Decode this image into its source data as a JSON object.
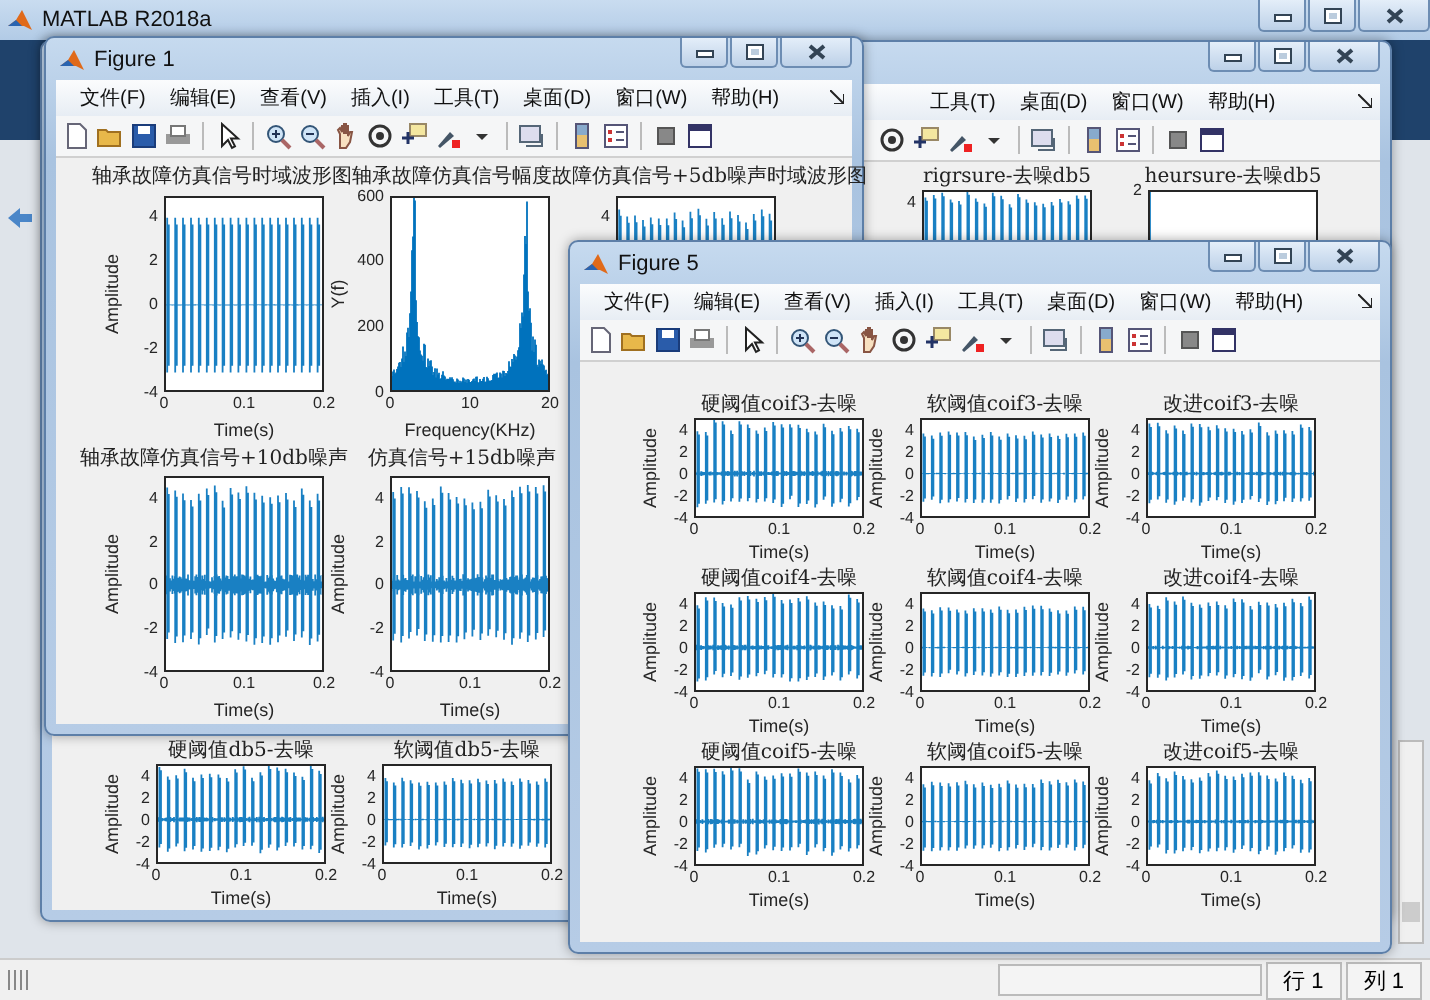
{
  "app": {
    "title": "MATLAB R2018a"
  },
  "status_bar": {
    "row": "行 1",
    "col": "列 1"
  },
  "figure_back": {
    "menu": [
      "工具(T)",
      "桌面(D)",
      "窗口(W)",
      "帮助(H)"
    ],
    "rows": [
      {
        "plots": [
          {
            "kind": "hard",
            "title": "rigrsure-去噪db5",
            "yticks": [
              "4"
            ]
          },
          {
            "kind": "sparse",
            "title": "heursure-去噪db5",
            "yticks": [
              "2"
            ]
          }
        ]
      },
      {
        "plots": [
          {
            "kind": "hard",
            "title": "硬阈值db5-去噪",
            "ylabel": "Amplitude",
            "xlabel": "Time(s)",
            "yticks": [
              "4",
              "2",
              "0",
              "-2",
              "-4"
            ],
            "xticks": [
              "0",
              "0.1",
              "0.2"
            ]
          },
          {
            "kind": "soft",
            "title": "软阈值db5-去噪",
            "ylabel": "Amplitude",
            "xlabel": "Time(s)",
            "yticks": [
              "4",
              "2",
              "0",
              "-2",
              "-4"
            ],
            "xticks": [
              "0",
              "0.1",
              "0.2"
            ]
          }
        ]
      }
    ]
  },
  "figure_1": {
    "title": "Figure 1",
    "menu": [
      "文件(F)",
      "编辑(E)",
      "查看(V)",
      "插入(I)",
      "工具(T)",
      "桌面(D)",
      "窗口(W)",
      "帮助(H)"
    ],
    "rows": [
      {
        "plots": [
          {
            "kind": "clean",
            "title": "轴承故障仿真信号时域波形图",
            "ylabel": "Amplitude",
            "xlabel": "Time(s)",
            "yticks": [
              "4",
              "2",
              "0",
              "-2",
              "-4"
            ],
            "xticks": [
              "0",
              "0.1",
              "0.2"
            ]
          },
          {
            "kind": "spectrum",
            "title": "轴承故障仿真信号幅度",
            "ylabel": "Y(f)",
            "xlabel": "Frequency(KHz)",
            "yticks": [
              "600",
              "400",
              "200",
              "0"
            ],
            "xticks": [
              "0",
              "10",
              "20"
            ]
          },
          {
            "kind": "noisy",
            "title": "故障仿真信号+5db噪声时域波形图",
            "yticks": [
              "4"
            ]
          }
        ]
      },
      {
        "plots": [
          {
            "kind": "noisy",
            "title": "轴承故障仿真信号+10db噪声",
            "ylabel": "Amplitude",
            "xlabel": "Time(s)",
            "yticks": [
              "4",
              "2",
              "0",
              "-2",
              "-4"
            ],
            "xticks": [
              "0",
              "0.1",
              "0.2"
            ]
          },
          {
            "kind": "noisy",
            "title": "仿真信号+15db噪声",
            "ylabel": "Amplitude",
            "xlabel": "Time(s)",
            "yticks": [
              "4",
              "2",
              "0",
              "-2",
              "-4"
            ],
            "xticks": [
              "0",
              "0.1",
              "0.2"
            ]
          }
        ]
      }
    ]
  },
  "figure_5": {
    "title": "Figure 5",
    "menu": [
      "文件(F)",
      "编辑(E)",
      "查看(V)",
      "插入(I)",
      "工具(T)",
      "桌面(D)",
      "窗口(W)",
      "帮助(H)"
    ],
    "rows": [
      {
        "plots": [
          {
            "kind": "hard",
            "title": "硬阈值coif3-去噪",
            "ylabel": "Amplitude",
            "xlabel": "Time(s)",
            "yticks": [
              "4",
              "2",
              "0",
              "-2",
              "-4"
            ],
            "xticks": [
              "0",
              "0.1",
              "0.2"
            ]
          },
          {
            "kind": "soft",
            "title": "软阈值coif3-去噪",
            "ylabel": "Amplitude",
            "xlabel": "Time(s)",
            "yticks": [
              "4",
              "2",
              "0",
              "-2",
              "-4"
            ],
            "xticks": [
              "0",
              "0.1",
              "0.2"
            ]
          },
          {
            "kind": "improved",
            "title": "改进coif3-去噪",
            "ylabel": "Amplitude",
            "xlabel": "Time(s)",
            "yticks": [
              "4",
              "2",
              "0",
              "-2",
              "-4"
            ],
            "xticks": [
              "0",
              "0.1",
              "0.2"
            ]
          }
        ]
      },
      {
        "plots": [
          {
            "kind": "hard",
            "title": "硬阈值coif4-去噪",
            "ylabel": "Amplitude",
            "xlabel": "Time(s)",
            "yticks": [
              "4",
              "2",
              "0",
              "-2",
              "-4"
            ],
            "xticks": [
              "0",
              "0.1",
              "0.2"
            ]
          },
          {
            "kind": "soft",
            "title": "软阈值coif4-去噪",
            "ylabel": "Amplitude",
            "xlabel": "Time(s)",
            "yticks": [
              "4",
              "2",
              "0",
              "-2",
              "-4"
            ],
            "xticks": [
              "0",
              "0.1",
              "0.2"
            ]
          },
          {
            "kind": "improved",
            "title": "改进coif4-去噪",
            "ylabel": "Amplitude",
            "xlabel": "Time(s)",
            "yticks": [
              "4",
              "2",
              "0",
              "-2",
              "-4"
            ],
            "xticks": [
              "0",
              "0.1",
              "0.2"
            ]
          }
        ]
      },
      {
        "plots": [
          {
            "kind": "hard",
            "title": "硬阈值coif5-去噪",
            "ylabel": "Amplitude",
            "xlabel": "Time(s)",
            "yticks": [
              "4",
              "2",
              "0",
              "-2",
              "-4"
            ],
            "xticks": [
              "0",
              "0.1",
              "0.2"
            ]
          },
          {
            "kind": "soft",
            "title": "软阈值coif5-去噪",
            "ylabel": "Amplitude",
            "xlabel": "Time(s)",
            "yticks": [
              "4",
              "2",
              "0",
              "-2",
              "-4"
            ],
            "xticks": [
              "0",
              "0.1",
              "0.2"
            ]
          },
          {
            "kind": "improved",
            "title": "改进coif5-去噪",
            "ylabel": "Amplitude",
            "xlabel": "Time(s)",
            "yticks": [
              "4",
              "2",
              "0",
              "-2",
              "-4"
            ],
            "xticks": [
              "0",
              "0.1",
              "0.2"
            ]
          }
        ]
      }
    ]
  }
}
